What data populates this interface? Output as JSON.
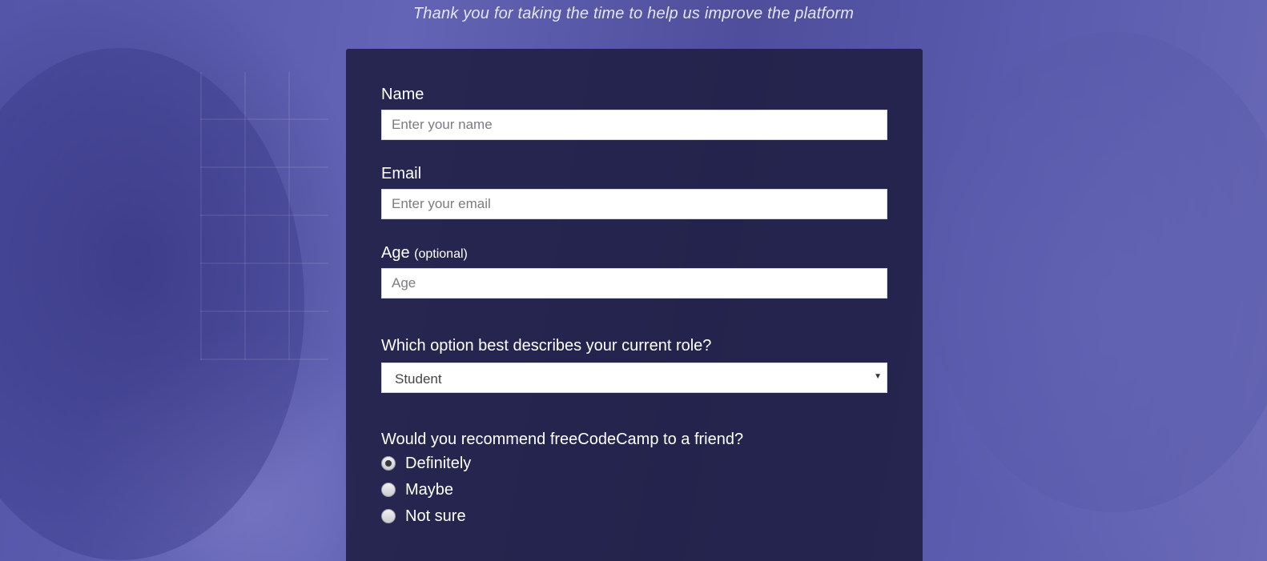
{
  "header": {
    "subtitle": "Thank you for taking the time to help us improve the platform"
  },
  "form": {
    "name": {
      "label": "Name",
      "placeholder": "Enter your name"
    },
    "email": {
      "label": "Email",
      "placeholder": "Enter your email"
    },
    "age": {
      "label": "Age",
      "label_suffix": "(optional)",
      "placeholder": "Age"
    },
    "role": {
      "label": "Which option best describes your current role?",
      "selected": "Student"
    },
    "recommend": {
      "label": "Would you recommend freeCodeCamp to a friend?",
      "options": [
        {
          "label": "Definitely",
          "checked": true
        },
        {
          "label": "Maybe",
          "checked": false
        },
        {
          "label": "Not sure",
          "checked": false
        }
      ]
    }
  },
  "colors": {
    "background": "#5454a8",
    "card": "#1e1e42",
    "text": "#ffffff"
  }
}
